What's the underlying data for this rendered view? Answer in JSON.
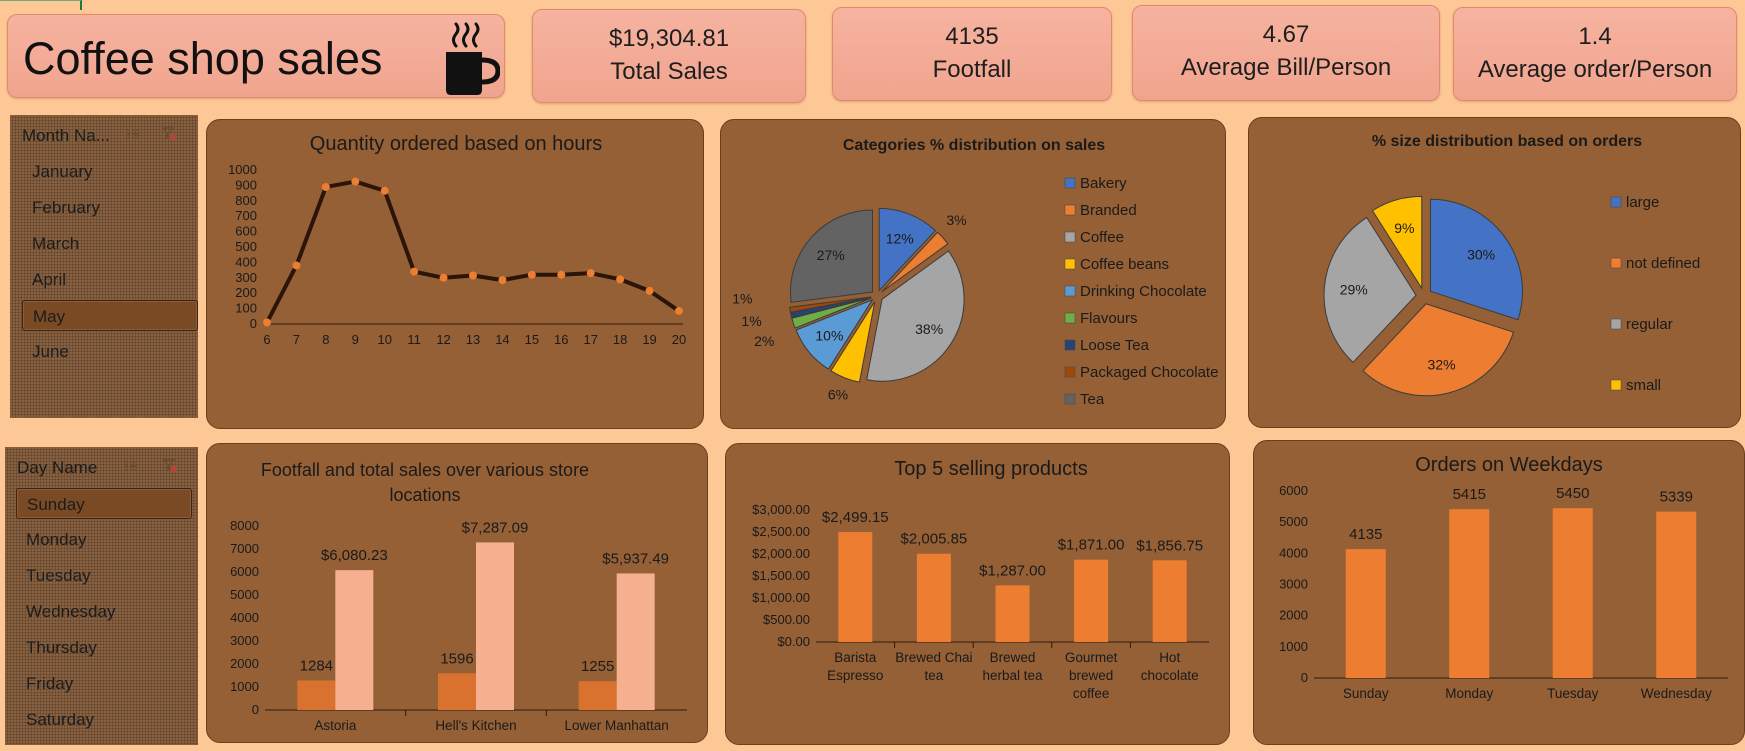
{
  "dashboard": {
    "title": "Coffee shop sales",
    "icon": "coffee-cup-icon"
  },
  "kpis": [
    {
      "value": "$19,304.81",
      "label": "Total Sales"
    },
    {
      "value": "4135",
      "label": "Footfall"
    },
    {
      "value": "4.67",
      "label": "Average Bill/Person"
    },
    {
      "value": "1.4",
      "label": "Average order/Person"
    }
  ],
  "slicers": {
    "month": {
      "header": "Month Na...",
      "items": [
        "January",
        "February",
        "March",
        "April",
        "May",
        "June"
      ],
      "selected": "May"
    },
    "day": {
      "header": "Day Name",
      "items": [
        "Sunday",
        "Monday",
        "Tuesday",
        "Wednesday",
        "Thursday",
        "Friday",
        "Saturday"
      ],
      "selected": "Sunday"
    }
  },
  "colors": {
    "background": "#fdc895",
    "panel": "#956036",
    "orange": "#ed7d31",
    "salmon": "#f4b08f",
    "line": "#2b1408"
  },
  "chart_data": [
    {
      "type": "line",
      "title": "Quantity ordered based on hours",
      "x": [
        6,
        7,
        8,
        9,
        10,
        11,
        12,
        13,
        14,
        15,
        16,
        17,
        18,
        19,
        20
      ],
      "series": [
        {
          "values": [
            10,
            380,
            890,
            925,
            865,
            340,
            300,
            315,
            285,
            320,
            320,
            330,
            290,
            215,
            85
          ]
        }
      ],
      "ylim": [
        0,
        1000
      ],
      "yticks": [
        "0",
        "100",
        "200",
        "300",
        "400",
        "500",
        "600",
        "700",
        "800",
        "900",
        "1000"
      ],
      "grid": false
    },
    {
      "type": "pie",
      "title": "Categories  % distribution on sales",
      "legend_position": "right",
      "slices": [
        {
          "label": "Bakery",
          "value": 12,
          "display": "12%",
          "color": "#4472c4"
        },
        {
          "label": "Branded",
          "value": 3,
          "display": "3%",
          "color": "#ed7d31"
        },
        {
          "label": "Coffee",
          "value": 38,
          "display": "38%",
          "color": "#a5a5a5"
        },
        {
          "label": "Coffee beans",
          "value": 6,
          "display": "6%",
          "color": "#ffc000"
        },
        {
          "label": "Drinking Chocolate",
          "value": 10,
          "display": "10%",
          "color": "#5b9bd5"
        },
        {
          "label": "Flavours",
          "value": 2,
          "display": "2%",
          "color": "#70ad47"
        },
        {
          "label": "Loose Tea",
          "value": 1,
          "display": "1%",
          "color": "#264478"
        },
        {
          "label": "Packaged Chocolate",
          "value": 1,
          "display": "1%",
          "color": "#9e480e"
        },
        {
          "label": "Tea",
          "value": 27,
          "display": "27%",
          "color": "#636363"
        }
      ]
    },
    {
      "type": "pie",
      "title": "% size distribution based on orders",
      "legend_position": "right",
      "slices": [
        {
          "label": "large",
          "value": 30,
          "display": "30%",
          "color": "#4472c4"
        },
        {
          "label": "not defined",
          "value": 32,
          "display": "32%",
          "color": "#ed7d31"
        },
        {
          "label": "regular",
          "value": 29,
          "display": "29%",
          "color": "#a5a5a5"
        },
        {
          "label": "small",
          "value": 9,
          "display": "9%",
          "color": "#ffc000"
        }
      ]
    },
    {
      "type": "bar",
      "title": "Footfall and total sales over various store locations",
      "title_lines": [
        "Footfall and total sales over various store",
        "locations"
      ],
      "categories": [
        "Astoria",
        "Hell's Kitchen",
        "Lower Manhattan"
      ],
      "series": [
        {
          "values": [
            1284,
            1596,
            1255
          ],
          "labels": [
            "1284",
            "1596",
            "1255"
          ],
          "color": "#d9722f"
        },
        {
          "values": [
            6080.23,
            7287.09,
            5937.49
          ],
          "labels": [
            "$6,080.23",
            "$7,287.09",
            "$5,937.49"
          ],
          "color": "#f4b08f"
        }
      ],
      "ylim": [
        0,
        8000
      ],
      "yticks": [
        "0",
        "1000",
        "2000",
        "3000",
        "4000",
        "5000",
        "6000",
        "7000",
        "8000"
      ]
    },
    {
      "type": "bar",
      "title": "Top 5 selling products",
      "categories": [
        [
          "Barista",
          "Espresso"
        ],
        [
          "Brewed Chai",
          "tea"
        ],
        [
          "Brewed",
          "herbal tea"
        ],
        [
          "Gourmet",
          "brewed",
          "coffee"
        ],
        [
          "Hot",
          "chocolate"
        ]
      ],
      "series": [
        {
          "values": [
            2499.15,
            2005.85,
            1287.0,
            1871.0,
            1856.75
          ],
          "labels": [
            "$2,499.15",
            "$2,005.85",
            "$1,287.00",
            "$1,871.00",
            "$1,856.75"
          ],
          "color": "#ed7d31"
        }
      ],
      "ylim": [
        0,
        3000
      ],
      "yticks": [
        "$0.00",
        "$500.00",
        "$1,000.00",
        "$1,500.00",
        "$2,000.00",
        "$2,500.00",
        "$3,000.00"
      ]
    },
    {
      "type": "bar",
      "title": "Orders on Weekdays",
      "categories": [
        "Sunday",
        "Monday",
        "Tuesday",
        "Wednesday"
      ],
      "series": [
        {
          "values": [
            4135,
            5415,
            5450,
            5339
          ],
          "labels": [
            "4135",
            "5415",
            "5450",
            "5339"
          ],
          "color": "#ed7d31"
        }
      ],
      "ylim": [
        0,
        6000
      ],
      "yticks": [
        "0",
        "1000",
        "2000",
        "3000",
        "4000",
        "5000",
        "6000"
      ]
    }
  ]
}
